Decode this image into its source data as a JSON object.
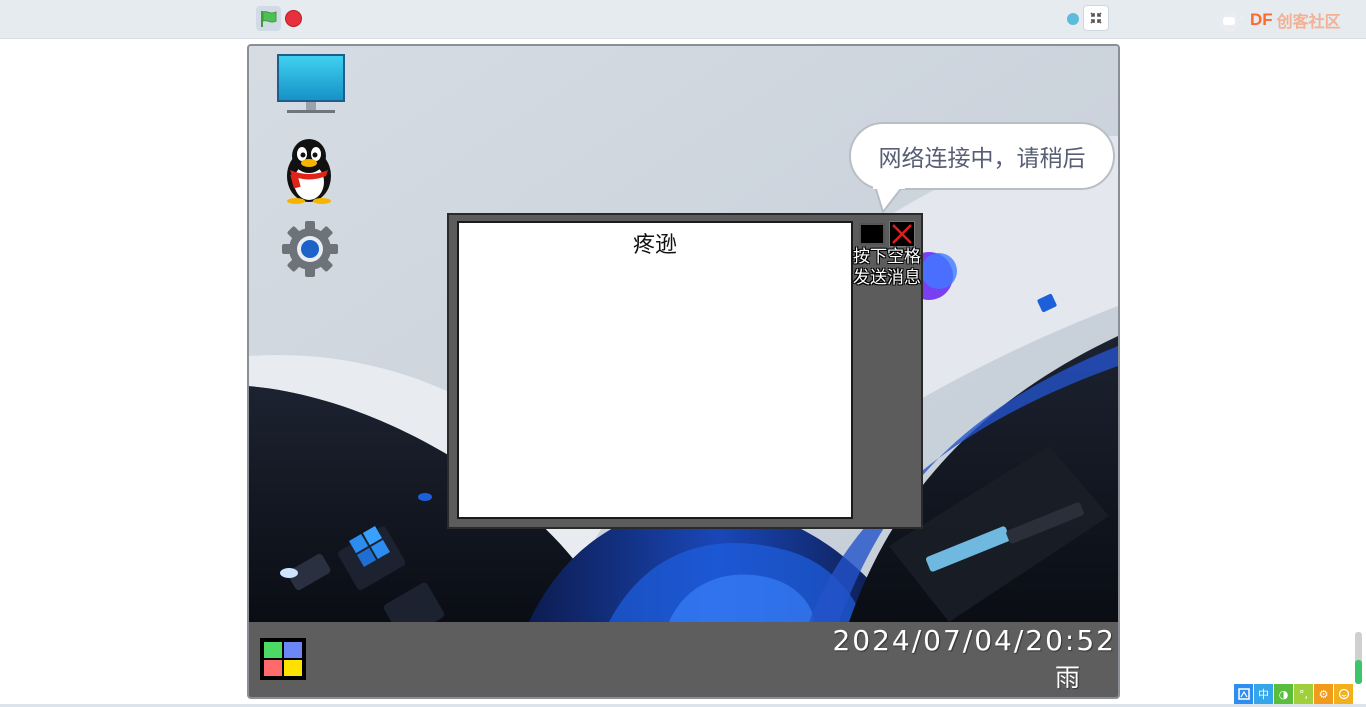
{
  "toolbar": {
    "green_flag": "green-flag-icon",
    "stop": "stop-icon",
    "fullscreen": "exit-fullscreen-icon",
    "brand": {
      "df": "DF",
      "name": "创客社区"
    }
  },
  "bubble": {
    "text": "网络连接中，请稍后"
  },
  "chat_window": {
    "title": "疼逊",
    "hint_line1": "按下空格",
    "hint_line2": "发送消息"
  },
  "taskbar": {
    "clock": "2024/07/04/20:52",
    "weather": "雨"
  },
  "desktop_icons": [
    "computer-icon",
    "qq-penguin-icon",
    "settings-gear-icon"
  ],
  "tray": [
    "中",
    "◑",
    "°,",
    "⚙"
  ],
  "colors": {
    "stage_bg": "#cfd6de",
    "taskbar": "#5e5e5e",
    "accent": "#1a6fd6"
  }
}
